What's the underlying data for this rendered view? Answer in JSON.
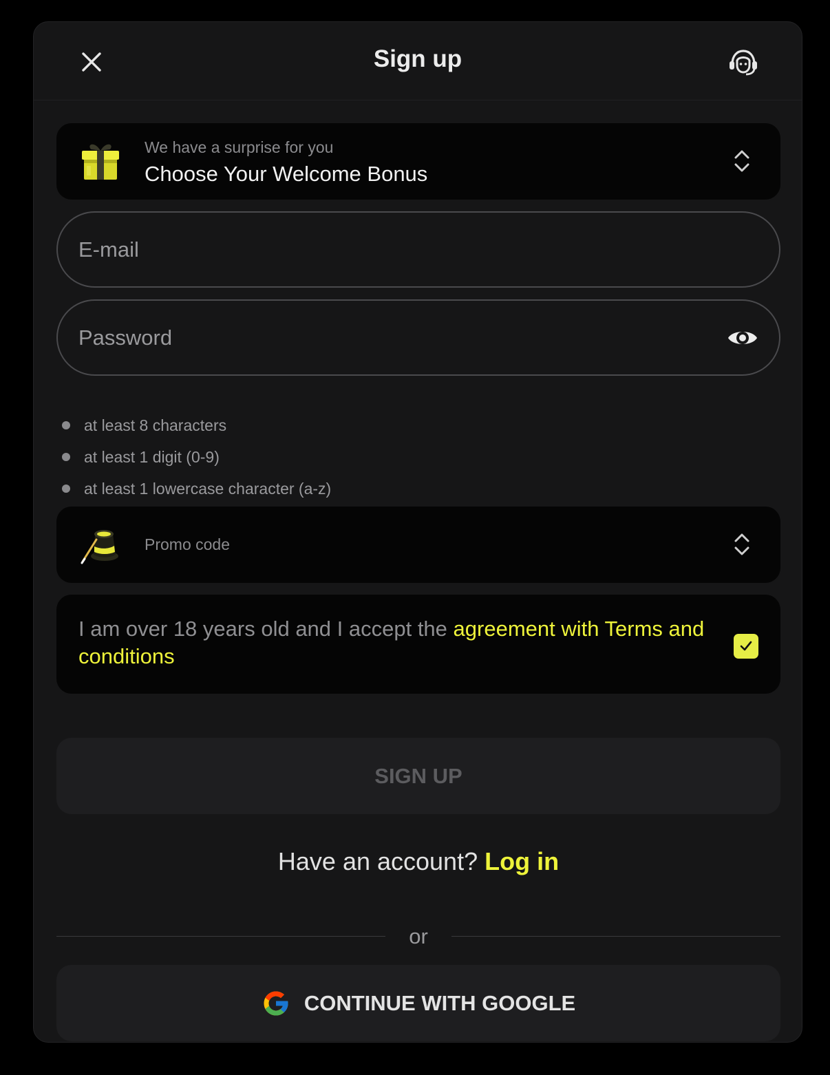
{
  "header": {
    "title": "Sign up",
    "close_icon": "close-icon",
    "support_icon": "headset-support-icon"
  },
  "bonus": {
    "subtitle": "We have a surprise for you",
    "title": "Choose Your Welcome Bonus",
    "icon": "gift-box-icon"
  },
  "email": {
    "placeholder": "E-mail",
    "value": ""
  },
  "password": {
    "placeholder": "Password",
    "value": "",
    "toggle_icon": "eye-icon"
  },
  "password_rules": [
    "at least 8 characters",
    "at least 1 digit (0-9)",
    "at least 1 lowercase character (a-z)"
  ],
  "promo": {
    "label": "Promo code",
    "icon": "magic-hat-icon"
  },
  "terms": {
    "text": "I am over 18 years old and I accept the ",
    "link": "agreement with Terms and conditions",
    "checked": true
  },
  "signup_button": "SIGN UP",
  "login_prompt": {
    "text": "Have an account? ",
    "link": "Log in"
  },
  "divider_text": "or",
  "google_button": {
    "label": "CONTINUE WITH GOOGLE",
    "icon": "google-icon"
  },
  "colors": {
    "accent": "#eef33a",
    "background": "#000000",
    "panel": "#161617",
    "card": "#050505"
  }
}
